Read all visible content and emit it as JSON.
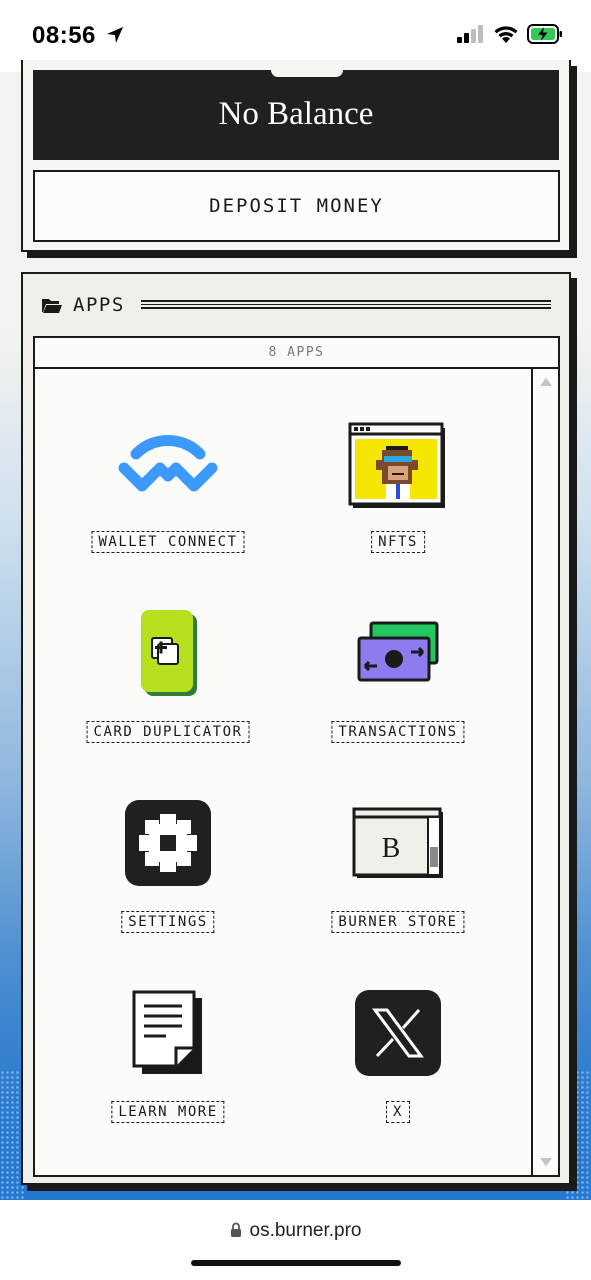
{
  "status_bar": {
    "time": "08:56",
    "icons": [
      "location-arrow-icon",
      "cellular-signal-icon",
      "wifi-icon",
      "battery-charging-icon"
    ]
  },
  "balance": {
    "text": "No Balance",
    "deposit_label": "DEPOSIT MONEY"
  },
  "apps": {
    "title": "APPS",
    "count_label": "8 APPS",
    "items": [
      {
        "label": "WALLET CONNECT",
        "icon": "walletconnect-icon"
      },
      {
        "label": "NFTS",
        "icon": "nft-ape-icon"
      },
      {
        "label": "CARD DUPLICATOR",
        "icon": "card-duplicator-icon"
      },
      {
        "label": "TRANSACTIONS",
        "icon": "money-transfer-icon"
      },
      {
        "label": "SETTINGS",
        "icon": "gear-icon"
      },
      {
        "label": "BURNER STORE",
        "icon": "store-window-icon"
      },
      {
        "label": "LEARN MORE",
        "icon": "document-icon"
      },
      {
        "label": "X",
        "icon": "x-logo-icon"
      }
    ]
  },
  "browser": {
    "url": "os.burner.pro"
  },
  "colors": {
    "ink": "#1a1a1a",
    "walletconnect_blue": "#3b99fc",
    "card_green": "#b6df1d",
    "money_purple": "#8c7cf0",
    "money_green": "#22c55e",
    "nft_yellow": "#f5e600",
    "battery_green": "#34c759"
  }
}
